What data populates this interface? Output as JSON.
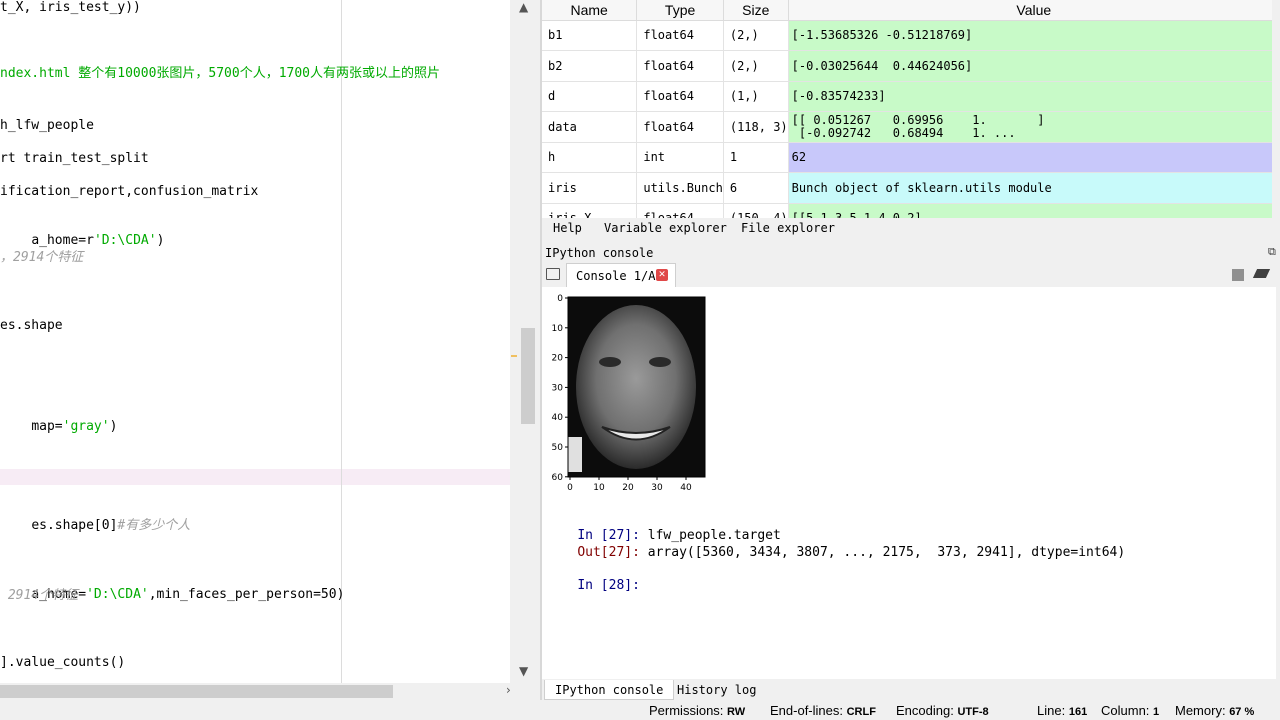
{
  "editor": {
    "lines": [
      {
        "text": "t_X, iris_test_y))",
        "kind": "code"
      },
      {
        "text": "ndex.html 整个有10000张图片，5700个人，1700人有两张或以上的照片",
        "kind": "green"
      },
      {
        "text": "h_lfw_people",
        "kind": "code"
      },
      {
        "text": "rt train_test_split",
        "kind": "code"
      },
      {
        "text": "ification_report,confusion_matrix",
        "kind": "code"
      },
      {
        "text": "a_home=r'D:\\CDA')",
        "kind": "code"
      },
      {
        "text": "，2914个特征",
        "kind": "comment"
      },
      {
        "text": "es.shape",
        "kind": "code"
      },
      {
        "text": "map='gray')",
        "kind": "code"
      },
      {
        "text": "es.shape[0]",
        "kind": "code",
        "comment": "#有多少个人"
      },
      {
        "text": "a_home='D:\\CDA',min_faces_per_person=50)",
        "kind": "code"
      },
      {
        "text": " 2914个特征",
        "kind": "comment"
      },
      {
        "text": "].value_counts()",
        "kind": "code"
      }
    ]
  },
  "variable_explorer": {
    "headers": [
      "Name",
      "Type",
      "Size",
      "Value"
    ],
    "rows": [
      {
        "name": "b1",
        "type": "float64",
        "size": "(2,)",
        "value": "[-1.53685326 -0.51218769]",
        "color": "#c8fac8"
      },
      {
        "name": "b2",
        "type": "float64",
        "size": "(2,)",
        "value": "[-0.03025644  0.44624056]",
        "color": "#c8fac8"
      },
      {
        "name": "d",
        "type": "float64",
        "size": "(1,)",
        "value": "[-0.83574233]",
        "color": "#c8fac8"
      },
      {
        "name": "data",
        "type": "float64",
        "size": "(118, 3)",
        "value": "[[ 0.051267   0.69956    1.       ]\n [-0.092742   0.68494    1. ...",
        "color": "#c8fac8"
      },
      {
        "name": "h",
        "type": "int",
        "size": "1",
        "value": "62",
        "color": "#c8c8fa"
      },
      {
        "name": "iris",
        "type": "utils.Bunch",
        "size": "6",
        "value": "Bunch object of sklearn.utils module",
        "color": "#c8fafa"
      },
      {
        "name": "iris_X",
        "type": "float64",
        "size": "(150, 4)",
        "value": "[[5.1 3.5 1.4 0.2]",
        "color": "#c8fac8"
      }
    ]
  },
  "top_tabs": [
    "Help",
    "Variable explorer",
    "File explorer"
  ],
  "console_pane_title": "IPython console",
  "console_tab": "Console 1/A",
  "plot": {
    "y_ticks": [
      "0",
      "10",
      "20",
      "30",
      "40",
      "50",
      "60"
    ],
    "x_ticks": [
      "0",
      "10",
      "20",
      "30",
      "40"
    ]
  },
  "console_lines": {
    "in27_prompt": "In [27]:",
    "in27_code": " lfw_people.target",
    "out27_prompt": "Out[27]:",
    "out27_value": " array([5360, 3434, 3807, ..., 2175,  373, 2941], dtype=int64)",
    "in28_prompt": "In [28]:"
  },
  "bottom_tabs": [
    "IPython console",
    "History log"
  ],
  "status": {
    "permissions_label": "Permissions:",
    "permissions_value": "RW",
    "eol_label": "End-of-lines:",
    "eol_value": "CRLF",
    "encoding_label": "Encoding:",
    "encoding_value": "UTF-8",
    "line_label": "Line:",
    "line_value": "161",
    "column_label": "Column:",
    "column_value": "1",
    "memory_label": "Memory:",
    "memory_value": "67 %"
  }
}
